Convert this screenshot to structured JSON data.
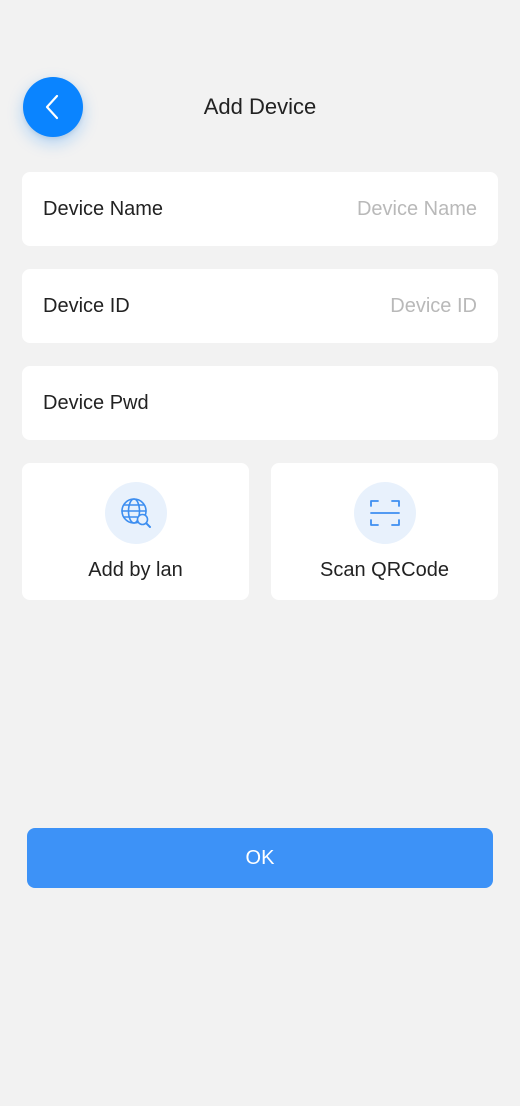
{
  "header": {
    "back_icon": "chevron-left-icon",
    "title": "Add Device"
  },
  "form": {
    "device_name": {
      "label": "Device Name",
      "value": "",
      "placeholder": "Device Name"
    },
    "device_id": {
      "label": "Device ID",
      "value": "",
      "placeholder": "Device ID"
    },
    "device_pwd": {
      "label": "Device Pwd",
      "value": "",
      "placeholder": ""
    }
  },
  "options": [
    {
      "label": "Add by lan",
      "icon": "globe-search-icon"
    },
    {
      "label": "Scan QRCode",
      "icon": "scan-frame-icon"
    }
  ],
  "actions": {
    "ok_label": "OK"
  },
  "colors": {
    "accent": "#0a84ff",
    "button": "#3d92f7",
    "icon_bg": "#e8f1fc",
    "background": "#f2f2f2",
    "placeholder": "#b9b9b9"
  }
}
